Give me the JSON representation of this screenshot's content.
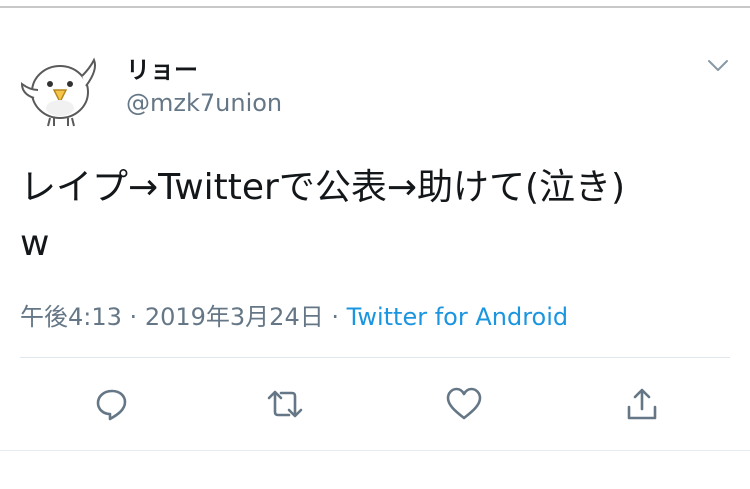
{
  "user": {
    "name": "リョー",
    "handle": "@mzk7union",
    "avatar": "white-bird-icon"
  },
  "tweet": {
    "text_line1": "レイプ→Twitterで公表→助けて(泣き)",
    "text_line2": "w",
    "time": "午後4:13",
    "separator": "·",
    "date": "2019年3月24日",
    "source": "Twitter for Android"
  },
  "actions": [
    {
      "icon": "reply-icon"
    },
    {
      "icon": "retweet-icon"
    },
    {
      "icon": "like-heart-icon"
    },
    {
      "icon": "share-icon"
    }
  ],
  "colors": {
    "text": "#14171a",
    "muted": "#657786",
    "link": "#1b95e0",
    "border": "#e1e8ed",
    "icon": "#657786"
  }
}
